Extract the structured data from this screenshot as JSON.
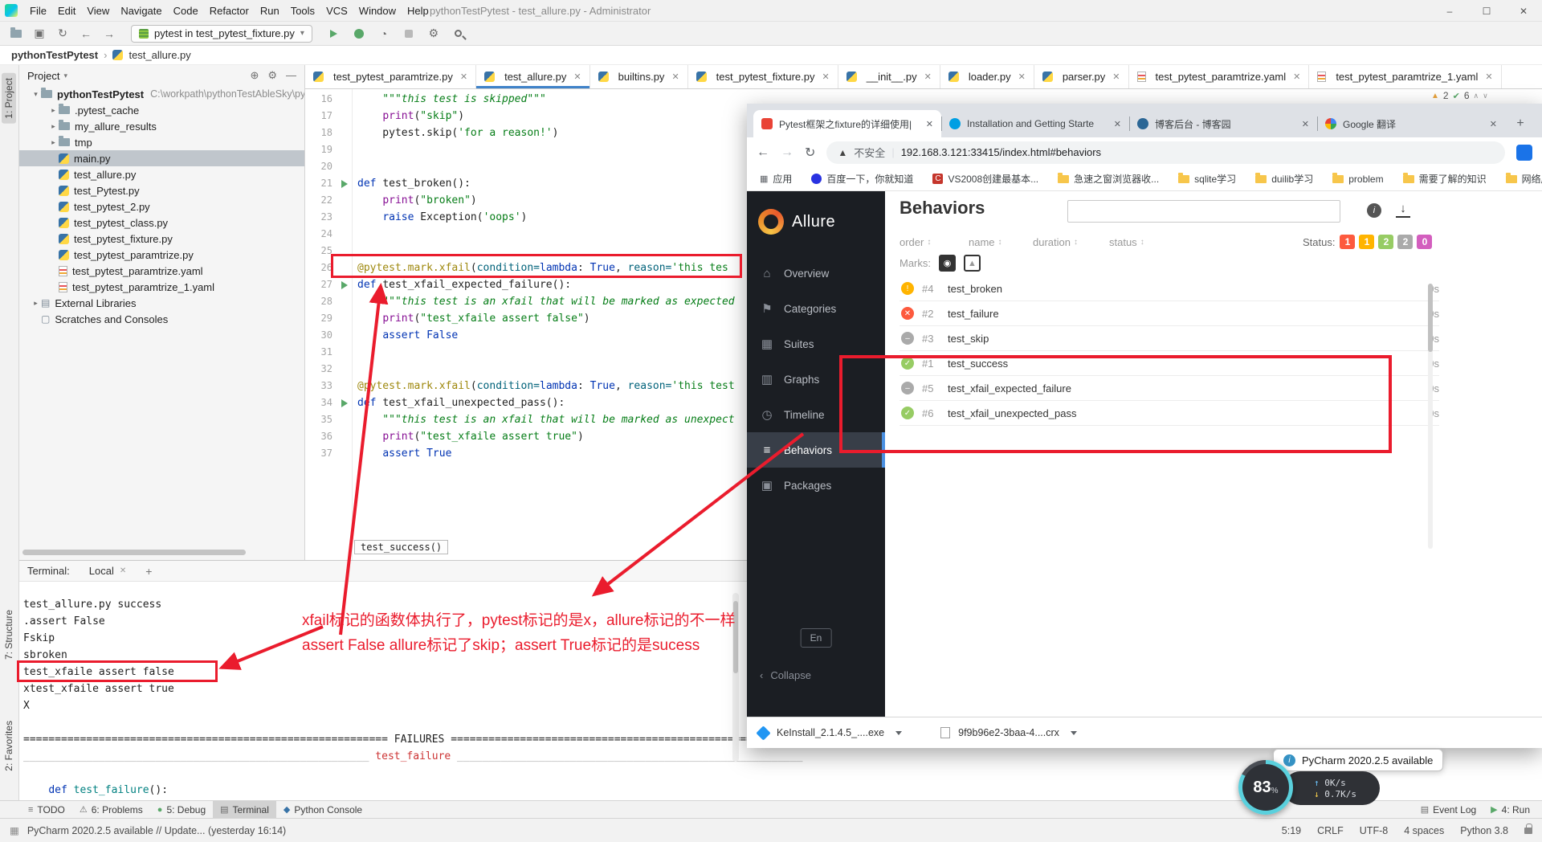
{
  "titlebar": {
    "menu": [
      "File",
      "Edit",
      "View",
      "Navigate",
      "Code",
      "Refactor",
      "Run",
      "Tools",
      "VCS",
      "Window",
      "Help"
    ],
    "title": "pythonTestPytest - test_allure.py - Administrator",
    "window_controls": [
      "minimize",
      "maximize",
      "close"
    ]
  },
  "toolbar": {
    "icons_left": [
      "open-folder",
      "save-all",
      "sync",
      "back",
      "forward"
    ],
    "run_config": "pytest in test_pytest_fixture.py",
    "icons_right": [
      "run",
      "debug",
      "coverage",
      "stop",
      "settings",
      "search"
    ]
  },
  "breadcrumb": {
    "root": "pythonTestPytest",
    "file": "test_allure.py"
  },
  "tool_stripes": {
    "left_top": "1: Project",
    "left_bottom_1": "7: Structure",
    "left_bottom_2": "2: Favorites"
  },
  "project": {
    "header": "Project",
    "tree": [
      {
        "label": "pythonTestPytest",
        "path": "C:\\workpath\\pythonTestAbleSky\\py...",
        "icon": "folder",
        "indent": 0,
        "chev": "down",
        "bold": true
      },
      {
        "label": ".pytest_cache",
        "icon": "folder",
        "indent": 1,
        "chev": "right"
      },
      {
        "label": "my_allure_results",
        "icon": "folder",
        "indent": 1,
        "chev": "right"
      },
      {
        "label": "tmp",
        "icon": "folder",
        "indent": 1,
        "chev": "right"
      },
      {
        "label": "main.py",
        "icon": "python",
        "indent": 1,
        "selected": true
      },
      {
        "label": "test_allure.py",
        "icon": "python",
        "indent": 1
      },
      {
        "label": "test_Pytest.py",
        "icon": "python",
        "indent": 1
      },
      {
        "label": "test_pytest_2.py",
        "icon": "python",
        "indent": 1
      },
      {
        "label": "test_pytest_class.py",
        "icon": "python",
        "indent": 1
      },
      {
        "label": "test_pytest_fixture.py",
        "icon": "python",
        "indent": 1
      },
      {
        "label": "test_pytest_paramtrize.py",
        "icon": "python",
        "indent": 1
      },
      {
        "label": "test_pytest_paramtrize.yaml",
        "icon": "yaml",
        "indent": 1
      },
      {
        "label": "test_pytest_paramtrize_1.yaml",
        "icon": "yaml",
        "indent": 1
      },
      {
        "label": "External Libraries",
        "icon": "lib",
        "indent": 0,
        "chev": "right"
      },
      {
        "label": "Scratches and Consoles",
        "icon": "scratch",
        "indent": 0
      }
    ]
  },
  "editor": {
    "tabs": [
      {
        "label": "test_pytest_paramtrize.py",
        "icon": "python"
      },
      {
        "label": "test_allure.py",
        "icon": "python",
        "active": true
      },
      {
        "label": "builtins.py",
        "icon": "python"
      },
      {
        "label": "test_pytest_fixture.py",
        "icon": "python"
      },
      {
        "label": "__init__.py",
        "icon": "python"
      },
      {
        "label": "loader.py",
        "icon": "python"
      },
      {
        "label": "parser.py",
        "icon": "python"
      },
      {
        "label": "test_pytest_paramtrize.yaml",
        "icon": "yaml"
      },
      {
        "label": "test_pytest_paramtrize_1.yaml",
        "icon": "yaml"
      }
    ],
    "inspections": {
      "warnings": "2",
      "passed": "6"
    },
    "first_line": 16,
    "lines": [
      {
        "s": [
          {
            "c": "doc",
            "t": "    \"\"\"this test is skipped\"\"\""
          }
        ]
      },
      {
        "s": [
          {
            "t": "    "
          },
          {
            "c": "bi",
            "t": "print"
          },
          {
            "t": "("
          },
          {
            "c": "str",
            "t": "\"skip\""
          },
          {
            "t": ")"
          }
        ]
      },
      {
        "s": [
          {
            "t": "    pytest.skip("
          },
          {
            "c": "str",
            "t": "'for a reason!'"
          },
          {
            "t": ")"
          }
        ]
      },
      {
        "s": []
      },
      {
        "s": []
      },
      {
        "run": true,
        "s": [
          {
            "c": "kw",
            "t": "def "
          },
          {
            "t": "test_broken():"
          }
        ]
      },
      {
        "s": [
          {
            "t": "    "
          },
          {
            "c": "bi",
            "t": "print"
          },
          {
            "t": "("
          },
          {
            "c": "str",
            "t": "\"broken\""
          },
          {
            "t": ")"
          }
        ]
      },
      {
        "s": [
          {
            "t": "    "
          },
          {
            "c": "kw",
            "t": "raise "
          },
          {
            "t": "Exception("
          },
          {
            "c": "str",
            "t": "'oops'"
          },
          {
            "t": ")"
          }
        ]
      },
      {
        "s": []
      },
      {
        "s": []
      },
      {
        "s": [
          {
            "c": "dec",
            "t": "@pytest.mark.xfail"
          },
          {
            "t": "("
          },
          {
            "c": "arg",
            "t": "condition="
          },
          {
            "c": "kw",
            "t": "lambda"
          },
          {
            "t": ": "
          },
          {
            "c": "kw",
            "t": "True"
          },
          {
            "t": ", "
          },
          {
            "c": "arg",
            "t": "reason="
          },
          {
            "c": "str",
            "t": "'this tes"
          }
        ]
      },
      {
        "run": true,
        "s": [
          {
            "c": "kw",
            "t": "def "
          },
          {
            "t": "test_xfail_expected_failure():"
          }
        ]
      },
      {
        "s": [
          {
            "c": "doc",
            "t": "    \"\"\"this test is an xfail that will be marked as expected"
          }
        ]
      },
      {
        "s": [
          {
            "t": "    "
          },
          {
            "c": "bi",
            "t": "print"
          },
          {
            "t": "("
          },
          {
            "c": "str",
            "t": "\"test_xfaile assert false\""
          },
          {
            "t": ")"
          }
        ]
      },
      {
        "s": [
          {
            "t": "    "
          },
          {
            "c": "kw",
            "t": "assert "
          },
          {
            "c": "kw",
            "t": "False"
          }
        ]
      },
      {
        "s": []
      },
      {
        "s": []
      },
      {
        "s": [
          {
            "c": "dec",
            "t": "@pytest.mark.xfail"
          },
          {
            "t": "("
          },
          {
            "c": "arg",
            "t": "condition="
          },
          {
            "c": "kw",
            "t": "lambda"
          },
          {
            "t": ": "
          },
          {
            "c": "kw",
            "t": "True"
          },
          {
            "t": ", "
          },
          {
            "c": "arg",
            "t": "reason="
          },
          {
            "c": "str",
            "t": "'this test"
          }
        ]
      },
      {
        "run": true,
        "s": [
          {
            "c": "kw",
            "t": "def "
          },
          {
            "t": "test_xfail_unexpected_pass():"
          }
        ]
      },
      {
        "s": [
          {
            "c": "doc",
            "t": "    \"\"\"this test is an xfail that will be marked as unexpect"
          }
        ]
      },
      {
        "s": [
          {
            "t": "    "
          },
          {
            "c": "bi",
            "t": "print"
          },
          {
            "t": "("
          },
          {
            "c": "str",
            "t": "\"test_xfaile assert true\""
          },
          {
            "t": ")"
          }
        ]
      },
      {
        "s": [
          {
            "t": "    "
          },
          {
            "c": "kw",
            "t": "assert "
          },
          {
            "c": "kw",
            "t": "True"
          }
        ]
      }
    ],
    "context_hint": "test_success()"
  },
  "terminal": {
    "label": "Terminal:",
    "session_tab": "Local",
    "lines": [
      [
        {
          "t": "test_allure.py success"
        }
      ],
      [
        {
          "t": ".assert False"
        }
      ],
      [
        {
          "t": "Fskip"
        }
      ],
      [
        {
          "t": "sbroken"
        }
      ],
      [
        {
          "t": "test_xfaile assert false"
        }
      ],
      [
        {
          "t": "xtest_xfaile assert true"
        }
      ],
      [
        {
          "t": "X"
        }
      ],
      [],
      [
        {
          "t": "========================================================== FAILURES =========================================================="
        }
      ],
      [
        {
          "c": "dim",
          "t": "_______________________________________________________ "
        },
        {
          "c": "red",
          "t": "test_failure"
        },
        {
          "c": "dim",
          "t": " _______________________________________________________"
        }
      ],
      [],
      [
        {
          "t": "    "
        },
        {
          "c": "blue",
          "t": "def"
        },
        {
          "c": "teal",
          "t": " test_failure"
        },
        {
          "t": "():"
        }
      ]
    ]
  },
  "bottom_bar": {
    "left": [
      {
        "icon": "todo",
        "label": "TODO"
      },
      {
        "icon": "problems",
        "label": "6: Problems"
      },
      {
        "icon": "debug",
        "label": "5: Debug"
      },
      {
        "icon": "terminal",
        "label": "Terminal",
        "active": true
      },
      {
        "icon": "python",
        "label": "Python Console"
      }
    ],
    "right": [
      {
        "icon": "event-log",
        "label": "Event Log"
      },
      {
        "icon": "run",
        "label": "4: Run"
      }
    ]
  },
  "status_bar": {
    "left": "PyCharm 2020.2.5 available // Update... (yesterday 16:14)",
    "right": [
      "5:19",
      "CRLF",
      "UTF-8",
      "4 spaces",
      "Python 3.8"
    ]
  },
  "browser": {
    "tabs": [
      {
        "title": "Pytest框架之fixture的详细使用|",
        "favicon": "red",
        "active": true
      },
      {
        "title": "Installation and Getting Starte",
        "favicon": "pytest"
      },
      {
        "title": "博客后台 - 博客园",
        "favicon": "cnblogs"
      },
      {
        "title": "Google 翻译",
        "favicon": "google"
      }
    ],
    "address": {
      "security": "不安全",
      "url": "192.168.3.121:33415/index.html#behaviors"
    },
    "bookmarks": [
      {
        "label": "应用",
        "icon": "apps"
      },
      {
        "label": "百度一下，你就知道",
        "icon": "baidu"
      },
      {
        "label": "VS2008创建最基本...",
        "icon": "c-red"
      },
      {
        "label": "急速之窗浏览器收...",
        "icon": "folder"
      },
      {
        "label": "sqlite学习",
        "icon": "folder"
      },
      {
        "label": "duilib学习",
        "icon": "folder"
      },
      {
        "label": "problem",
        "icon": "folder"
      },
      {
        "label": "需要了解的知识",
        "icon": "folder"
      },
      {
        "label": "网络库",
        "icon": "folder"
      }
    ],
    "downloads": [
      {
        "name": "KeInstall_2.1.4.5_....exe",
        "icon": "blue"
      },
      {
        "name": "9f9b96e2-3baa-4....crx",
        "icon": "file"
      }
    ]
  },
  "allure": {
    "brand": "Allure",
    "nav": [
      {
        "label": "Overview",
        "icon": "home"
      },
      {
        "label": "Categories",
        "icon": "flag"
      },
      {
        "label": "Suites",
        "icon": "suitcase"
      },
      {
        "label": "Graphs",
        "icon": "chart"
      },
      {
        "label": "Timeline",
        "icon": "clock"
      },
      {
        "label": "Behaviors",
        "icon": "list",
        "active": true
      },
      {
        "label": "Packages",
        "icon": "package"
      }
    ],
    "lang": "En",
    "collapse": "Collapse",
    "page_title": "Behaviors",
    "columns": [
      "order",
      "name",
      "duration",
      "status"
    ],
    "status_label": "Status:",
    "status_badges": [
      {
        "count": "1",
        "color": "#fd5a3e"
      },
      {
        "count": "1",
        "color": "#ffb400"
      },
      {
        "count": "2",
        "color": "#97cc64"
      },
      {
        "count": "2",
        "color": "#aaaaaa"
      },
      {
        "count": "0",
        "color": "#d35ebe"
      }
    ],
    "marks_label": "Marks:",
    "rows": [
      {
        "status": "broken",
        "num": "#4",
        "name": "test_broken",
        "duration": "0s"
      },
      {
        "status": "failed",
        "num": "#2",
        "name": "test_failure",
        "duration": "0s"
      },
      {
        "status": "skipped",
        "num": "#3",
        "name": "test_skip",
        "duration": "0s"
      },
      {
        "status": "passed",
        "num": "#1",
        "name": "test_success",
        "duration": "0s"
      },
      {
        "status": "skipped",
        "num": "#5",
        "name": "test_xfail_expected_failure",
        "duration": "0s"
      },
      {
        "status": "passed",
        "num": "#6",
        "name": "test_xfail_unexpected_pass",
        "duration": "0s"
      }
    ]
  },
  "widgets": {
    "notification": "PyCharm 2020.2.5 available",
    "gauge_value": "83",
    "gauge_unit": "%",
    "net_up": "0K/s",
    "net_down": "0.7K/s"
  },
  "annotations": {
    "note_line1": "xfail标记的函数体执行了，pytest标记的是x，allure标记的不一样",
    "note_line2": "assert False allure标记了skip；assert True标记的是sucess"
  }
}
